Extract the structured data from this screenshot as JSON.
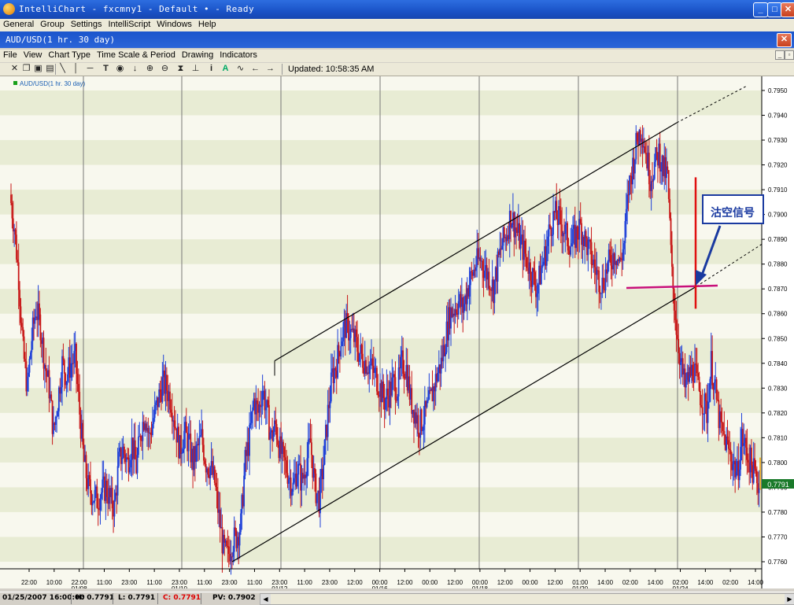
{
  "window": {
    "title": "IntelliChart - fxcmny1 - Default • - Ready",
    "min": "_",
    "max": "□",
    "close": "✕"
  },
  "menu": [
    "General",
    "Group",
    "Settings",
    "IntelliScript",
    "Windows",
    "Help"
  ],
  "chart_window": {
    "title": "AUD/USD(1 hr.  30 day)",
    "close": "✕"
  },
  "chart_menu": [
    "File",
    "View",
    "Chart Type",
    "Time Scale & Period",
    "Drawing",
    "Indicators"
  ],
  "toolbar": {
    "icons": [
      "crosshair-icon",
      "copy-icon",
      "save-icon",
      "print-icon",
      "line-tool-icon",
      "vertical-line-icon",
      "horizontal-line-icon",
      "text-tool-icon",
      "target-icon",
      "arrow-down-icon",
      "zoom-in-icon",
      "zoom-out-icon",
      "hourglass-icon",
      "fit-icon",
      "info-icon",
      "text-a-icon",
      "wave-icon",
      "arrow-left-icon",
      "arrow-right-icon"
    ],
    "updated": "Updated: 10:58:35 AM"
  },
  "chart_data": {
    "type": "candlestick",
    "legend": "AUD/USD(1 hr.  30 day)",
    "legend_color": "#1aa01a",
    "y_ticks": [
      "0.7950",
      "0.7940",
      "0.7930",
      "0.7920",
      "0.7910",
      "0.7900",
      "0.7890",
      "0.7880",
      "0.7870",
      "0.7860",
      "0.7850",
      "0.7840",
      "0.7830",
      "0.7820",
      "0.7810",
      "0.7800",
      "0.7790",
      "0.7780",
      "0.7770",
      "0.7760"
    ],
    "ylim": [
      0.7755,
      0.7957
    ],
    "current_price": "0.7791",
    "x_ticks": [
      {
        "t": "22:00",
        "d": ""
      },
      {
        "t": "10:00",
        "d": ""
      },
      {
        "t": "22:00",
        "d": "01/08"
      },
      {
        "t": "11:00",
        "d": ""
      },
      {
        "t": "23:00",
        "d": ""
      },
      {
        "t": "11:00",
        "d": ""
      },
      {
        "t": "23:00",
        "d": "01/10"
      },
      {
        "t": "11:00",
        "d": ""
      },
      {
        "t": "23:00",
        "d": ""
      },
      {
        "t": "11:00",
        "d": ""
      },
      {
        "t": "23:00",
        "d": "01/12"
      },
      {
        "t": "11:00",
        "d": ""
      },
      {
        "t": "23:00",
        "d": ""
      },
      {
        "t": "12:00",
        "d": ""
      },
      {
        "t": "00:00",
        "d": "01/16"
      },
      {
        "t": "12:00",
        "d": ""
      },
      {
        "t": "00:00",
        "d": ""
      },
      {
        "t": "12:00",
        "d": ""
      },
      {
        "t": "00:00",
        "d": "01/18"
      },
      {
        "t": "12:00",
        "d": ""
      },
      {
        "t": "00:00",
        "d": ""
      },
      {
        "t": "12:00",
        "d": ""
      },
      {
        "t": "01:00",
        "d": "01/20"
      },
      {
        "t": "14:00",
        "d": ""
      },
      {
        "t": "02:00",
        "d": ""
      },
      {
        "t": "14:00",
        "d": ""
      },
      {
        "t": "02:00",
        "d": "01/24"
      },
      {
        "t": "14:00",
        "d": ""
      },
      {
        "t": "02:00",
        "d": ""
      },
      {
        "t": "14:00",
        "d": ""
      }
    ],
    "price_path": [
      0.7908,
      0.7895,
      0.7875,
      0.7845,
      0.783,
      0.785,
      0.7862,
      0.7855,
      0.784,
      0.783,
      0.7812,
      0.7825,
      0.784,
      0.7835,
      0.784,
      0.7842,
      0.782,
      0.78,
      0.779,
      0.7787,
      0.7785,
      0.7788,
      0.779,
      0.7785,
      0.7782,
      0.78,
      0.7805,
      0.78,
      0.7808,
      0.7798,
      0.7812,
      0.782,
      0.781,
      0.7818,
      0.7825,
      0.7832,
      0.783,
      0.7825,
      0.7815,
      0.7805,
      0.7812,
      0.7808,
      0.78,
      0.7805,
      0.781,
      0.78,
      0.7798,
      0.7792,
      0.7778,
      0.7765,
      0.7762,
      0.7768,
      0.777,
      0.7775,
      0.78,
      0.781,
      0.7825,
      0.782,
      0.783,
      0.782,
      0.781,
      0.7815,
      0.7805,
      0.78,
      0.7795,
      0.779,
      0.7798,
      0.7792,
      0.78,
      0.7808,
      0.779,
      0.7785,
      0.78,
      0.782,
      0.7835,
      0.784,
      0.785,
      0.7855,
      0.7853,
      0.785,
      0.7845,
      0.7842,
      0.784,
      0.7838,
      0.7835,
      0.783,
      0.7825,
      0.7828,
      0.7832,
      0.783,
      0.784,
      0.7838,
      0.7825,
      0.782,
      0.7815,
      0.7818,
      0.7822,
      0.7828,
      0.7835,
      0.784,
      0.785,
      0.786,
      0.7862,
      0.7865,
      0.7862,
      0.787,
      0.7875,
      0.788,
      0.7882,
      0.7878,
      0.7875,
      0.787,
      0.788,
      0.7888,
      0.7892,
      0.79,
      0.7895,
      0.789,
      0.7885,
      0.788,
      0.7875,
      0.787,
      0.7878,
      0.7885,
      0.7895,
      0.79,
      0.7898,
      0.7895,
      0.789,
      0.7888,
      0.7892,
      0.7895,
      0.789,
      0.7885,
      0.788,
      0.7875,
      0.7872,
      0.7878,
      0.7882,
      0.7885,
      0.788,
      0.7888,
      0.791,
      0.792,
      0.793,
      0.7935,
      0.7925,
      0.7915,
      0.792,
      0.7925,
      0.7918,
      0.7915,
      0.7875,
      0.7855,
      0.784,
      0.783,
      0.7835,
      0.7838,
      0.783,
      0.7825,
      0.782,
      0.784,
      0.7828,
      0.7815,
      0.781,
      0.7805,
      0.78,
      0.7795,
      0.781,
      0.7805,
      0.78,
      0.7795,
      0.7791
    ],
    "channel": {
      "upper": [
        [
          "01/12 23:00",
          0.7841
        ],
        [
          "01/24 02:00",
          0.7937
        ]
      ],
      "lower": [
        [
          "01/10 23:00",
          0.776
        ],
        [
          "01/24 02:00",
          0.7871
        ]
      ]
    },
    "support_price": 0.7871,
    "annotation": {
      "text": "沽空信号",
      "color": "#1a3aa0"
    }
  },
  "status": {
    "datetime": "01/25/2007 16:00:00",
    "high": "H: 0.7791",
    "low": "L: 0.7791",
    "close": "C: 0.7791",
    "pv": "PV: 0.7902"
  }
}
